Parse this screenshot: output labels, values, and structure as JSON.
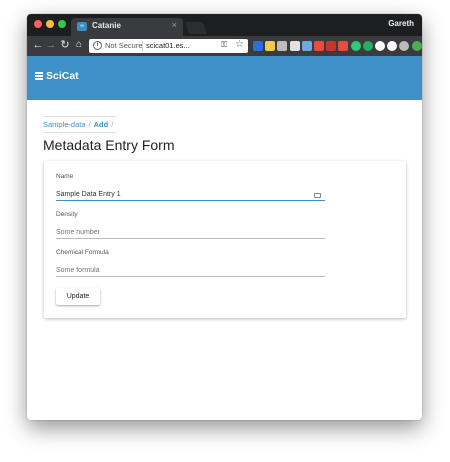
{
  "browser": {
    "tab_title": "Catanie",
    "tab_favicon_text": "∞",
    "tab_close": "×",
    "profile_name": "Gareth",
    "security_label": "Not Secure",
    "url": "scicat01.es...",
    "extension_colors": [
      "#2f6fd4",
      "#f2c94c",
      "#bdbdbd",
      "#e0e0e0",
      "#6fa8dc",
      "#e84c3d",
      "#c0392b",
      "#e74c3c",
      "#2ecc71",
      "#27ae60",
      "#ffffff",
      "#ffffff",
      "#bbbbbb",
      "#4caf50"
    ]
  },
  "app": {
    "title": "SciCat",
    "accent_color": "#3e91c8"
  },
  "breadcrumb": {
    "items": [
      "Sample-data",
      "Add"
    ],
    "separator": "/"
  },
  "page": {
    "title": "Metadata Entry Form"
  },
  "form": {
    "fields": [
      {
        "label": "Name",
        "value": "Sample Data Entry 1",
        "placeholder": ""
      },
      {
        "label": "Density",
        "value": "",
        "placeholder": "Some number"
      },
      {
        "label": "Chemical Formula",
        "value": "",
        "placeholder": "Some formula"
      }
    ],
    "submit_label": "Update"
  }
}
